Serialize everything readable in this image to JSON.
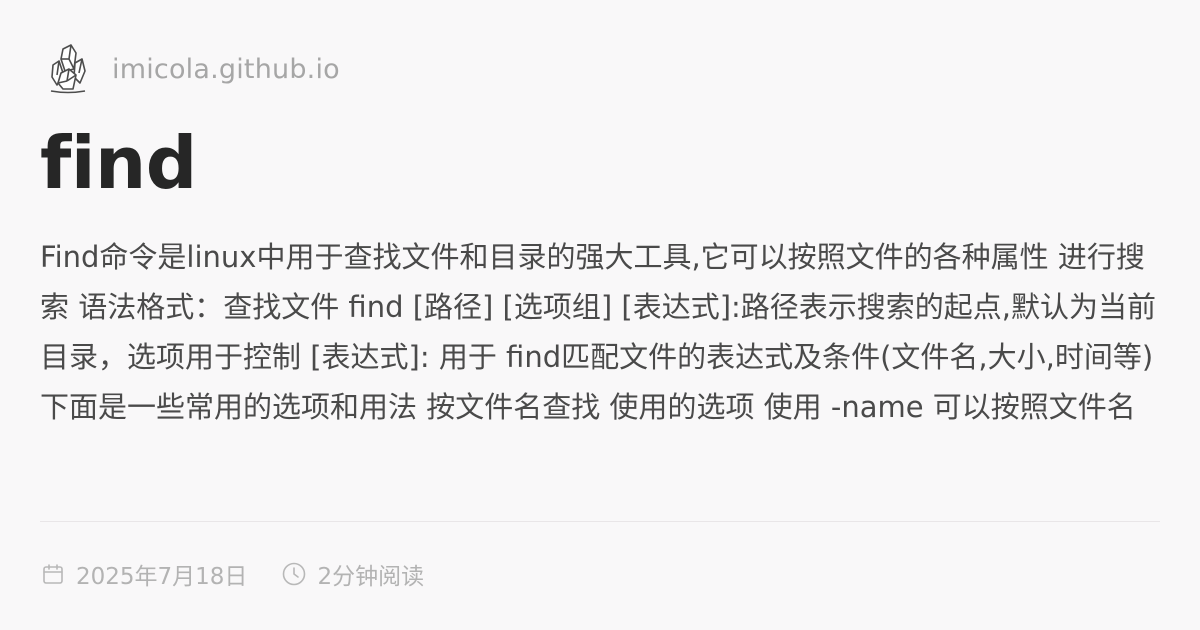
{
  "site": {
    "name": "imicola.github.io",
    "logo_icon": "crystal-logo-icon"
  },
  "post": {
    "title": "find",
    "description": "Find命令是linux中用于查找文件和目录的强大工具,它可以按照文件的各种属性 进行搜索 语法格式：查找文件 find [路径] [选项组] [表达式]:路径表示搜索的起点,默认为当前目录，选项用于控制 [表达式]: 用于 find匹配文件的表达式及条件(文件名,大小,时间等) 下面是一些常用的选项和用法 按文件名查找 使用的选项 使用 -name 可以按照文件名进行匹配查找,支持 shell 通配符 例如查找 test.txt 文件的: find ."
  },
  "meta": {
    "date": "2025年7月18日",
    "date_icon": "calendar-icon",
    "reading_time": "2分钟阅读",
    "reading_icon": "clock-icon"
  },
  "colors": {
    "background": "#f9f8f9",
    "title": "#262626",
    "text": "#4a4a4a",
    "muted": "#a6a6a6",
    "divider": "#e9e6e8"
  }
}
